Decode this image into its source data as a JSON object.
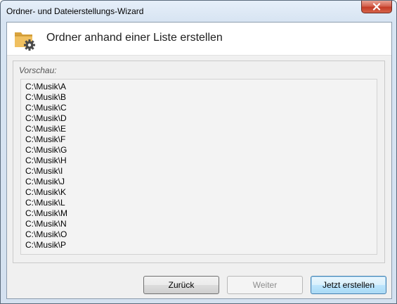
{
  "window": {
    "title": "Ordner- und Dateierstellungs-Wizard",
    "close_icon": "close-icon"
  },
  "header": {
    "icon": "folder-gear-icon",
    "title": "Ordner anhand einer Liste erstellen"
  },
  "preview": {
    "label": "Vorschau:",
    "items": [
      "C:\\Musik\\A",
      "C:\\Musik\\B",
      "C:\\Musik\\C",
      "C:\\Musik\\D",
      "C:\\Musik\\E",
      "C:\\Musik\\F",
      "C:\\Musik\\G",
      "C:\\Musik\\H",
      "C:\\Musik\\I",
      "C:\\Musik\\J",
      "C:\\Musik\\K",
      "C:\\Musik\\L",
      "C:\\Musik\\M",
      "C:\\Musik\\N",
      "C:\\Musik\\O",
      "C:\\Musik\\P"
    ]
  },
  "buttons": {
    "back": "Zurück",
    "next": "Weiter",
    "create": "Jetzt erstellen",
    "next_enabled": false
  },
  "colors": {
    "close_button": "#c43b26",
    "folder": "#e8b04a",
    "default_button_border": "#3c7fb1"
  }
}
